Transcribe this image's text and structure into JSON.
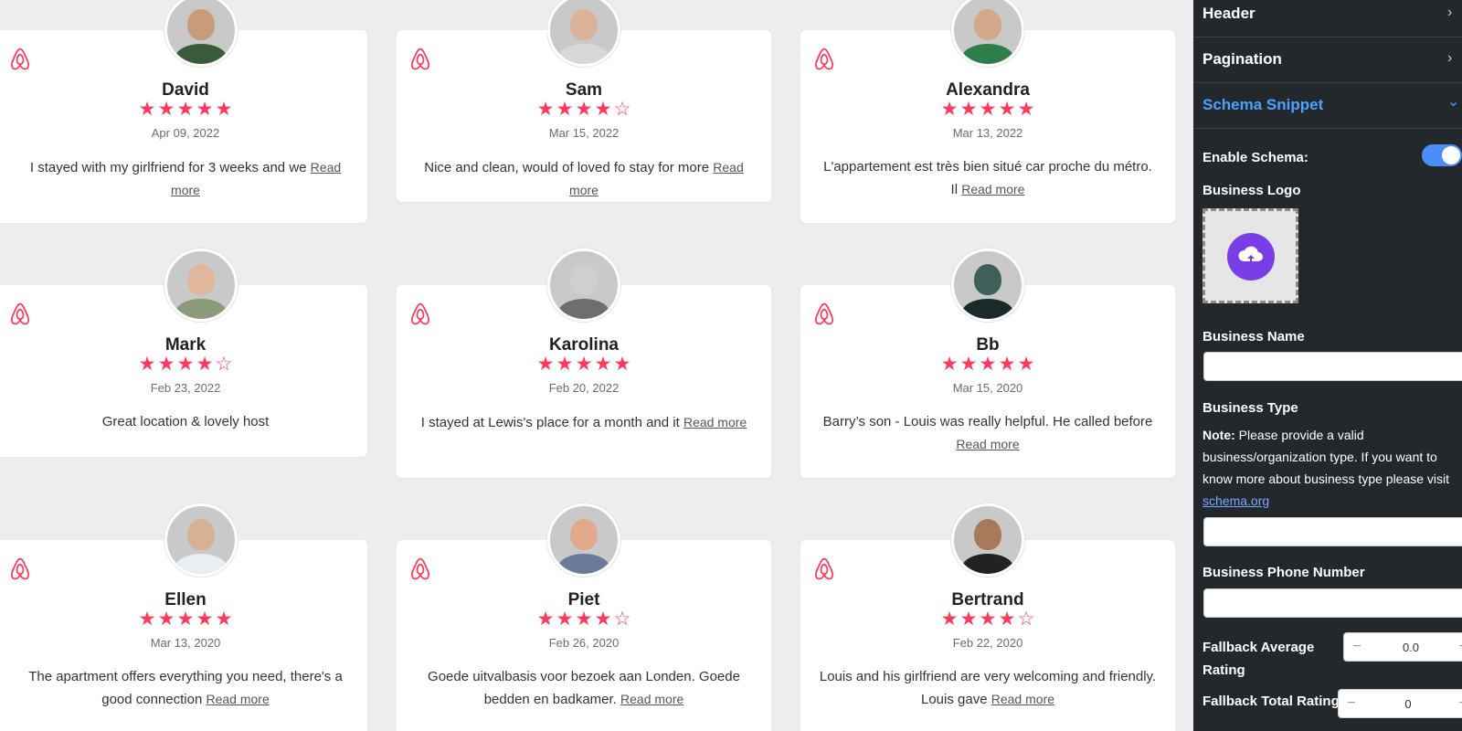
{
  "reviews": [
    {
      "name": "David",
      "rating": 5,
      "date": "Apr 09, 2022",
      "text": "I stayed with my girlfriend for 3 weeks and we",
      "read_more": "Read more",
      "skin": "#c89b7b",
      "shirt": "#3b5a3a"
    },
    {
      "name": "Sam",
      "rating": 4,
      "date": "Mar 15, 2022",
      "text": "Nice and clean, would of loved fo stay for more",
      "read_more": "Read more",
      "skin": "#d9b39a",
      "shirt": "#d8d8d8"
    },
    {
      "name": "Alexandra",
      "rating": 5,
      "date": "Mar 13, 2022",
      "text": "L'appartement est très bien situé car proche du métro. Il",
      "read_more": "Read more",
      "skin": "#d4a88a",
      "shirt": "#2f7d4a"
    },
    {
      "name": "Mark",
      "rating": 4,
      "date": "Feb 23, 2022",
      "text": "Great location & lovely host",
      "read_more": "",
      "skin": "#e0b79c",
      "shirt": "#8a9a7a"
    },
    {
      "name": "Karolina",
      "rating": 5,
      "date": "Feb 20, 2022",
      "text": "I stayed at Lewis's place for a month and it",
      "read_more": "Read more",
      "skin": "#cfcfcf",
      "shirt": "#6e6e6e"
    },
    {
      "name": "Bb",
      "rating": 5,
      "date": "Mar 15, 2020",
      "text": "Barry’s son - Louis was really helpful. He called before",
      "read_more": "Read more",
      "skin": "#3f5f5a",
      "shirt": "#1a2a2a"
    },
    {
      "name": "Ellen",
      "rating": 5,
      "date": "Mar 13, 2020",
      "text": "The apartment offers everything you need, there's a good connection",
      "read_more": "Read more",
      "skin": "#d8b194",
      "shirt": "#e8eef2"
    },
    {
      "name": "Piet",
      "rating": 4,
      "date": "Feb 26, 2020",
      "text": "Goede uitvalbasis voor bezoek aan Londen. Goede bedden en badkamer.",
      "read_more": "Read more",
      "skin": "#e2aa8c",
      "shirt": "#6a7a9a"
    },
    {
      "name": "Bertrand",
      "rating": 4,
      "date": "Feb 22, 2020",
      "text": "Louis and his girlfriend are very welcoming and friendly. Louis gave",
      "read_more": "Read more",
      "skin": "#a87a5a",
      "shirt": "#222222"
    }
  ],
  "panel": {
    "sections": [
      {
        "label": "Header",
        "chevron": "›"
      },
      {
        "label": "Pagination",
        "chevron": "›"
      },
      {
        "label": "Schema Snippet",
        "chevron": "⌄"
      }
    ],
    "enable_schema_label": "Enable Schema:",
    "enable_schema_on": true,
    "business_logo_label": "Business Logo",
    "upload_icon": "cloud-upload-icon",
    "business_name_label": "Business Name",
    "business_name_value": "",
    "business_type_label": "Business Type",
    "note_bold": "Note:",
    "note_text": " Please provide a valid business/organization type. If you want to know more about business type please visit ",
    "note_link": "schema.org",
    "business_type_value": "",
    "phone_label": "Business Phone Number",
    "phone_value": "",
    "fallback_avg_label": "Fallback Average Rating",
    "fallback_avg_value": "0.0",
    "fallback_total_label": "Fallback Total Rating",
    "fallback_total_value": "0",
    "minus": "−",
    "plus": "+"
  },
  "colors": {
    "accent": "#ff385c",
    "panel_bg": "#23282d",
    "active_link": "#4aa3ff",
    "toggle": "#4c8ef7",
    "upload_btn": "#7a3ee6"
  }
}
